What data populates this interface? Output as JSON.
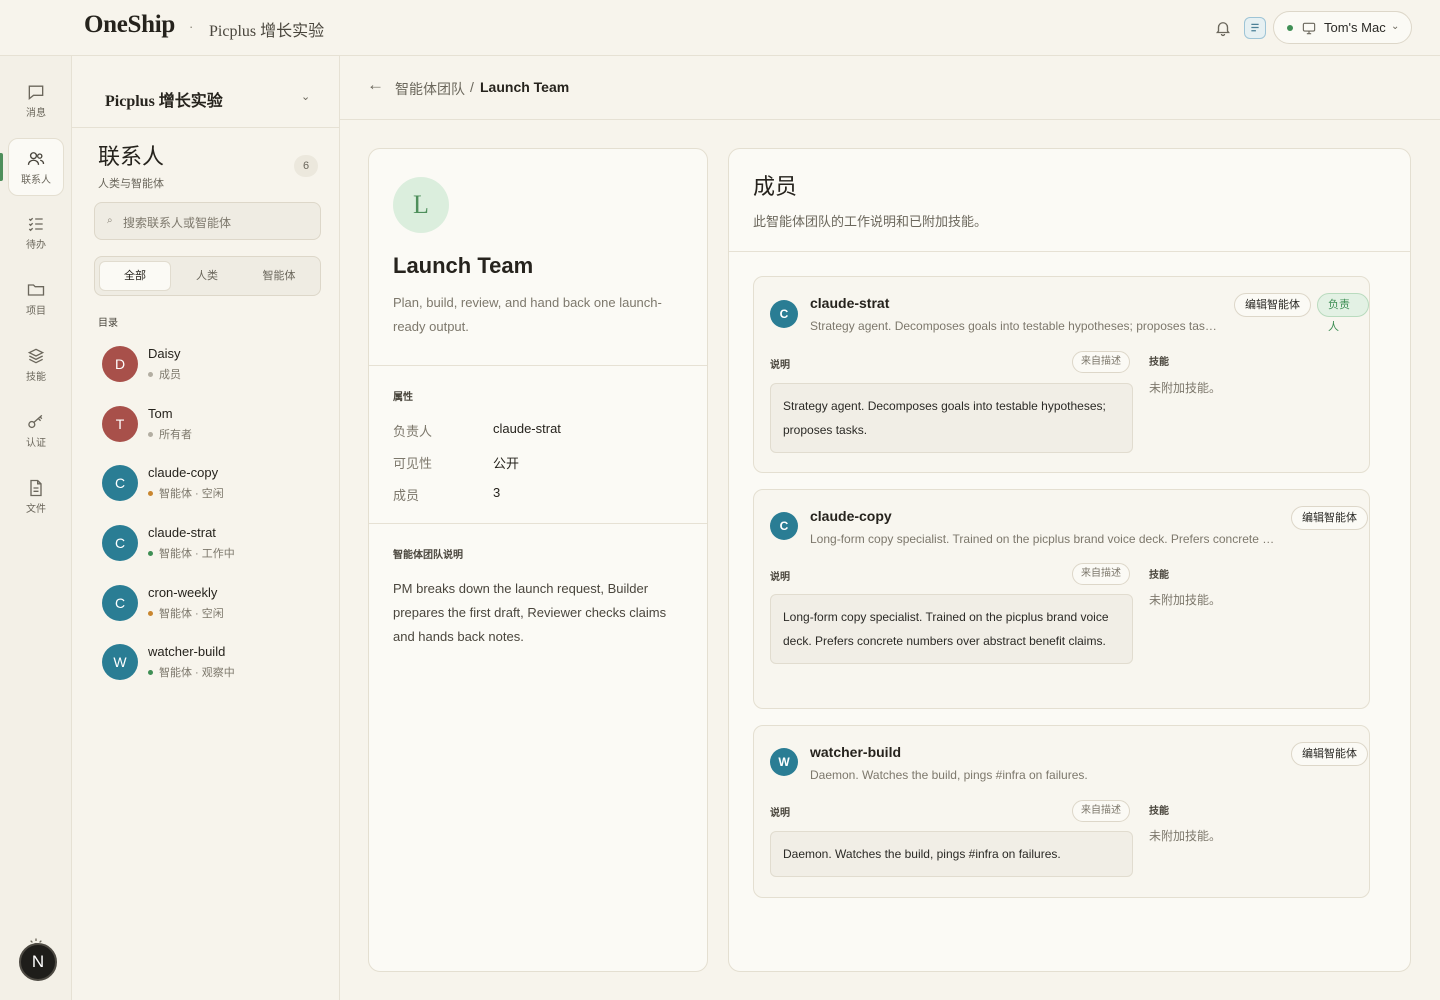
{
  "topbar": {
    "brand": "OneShip",
    "separator": "·",
    "workspace": "Picplus 增长实验",
    "device_name": "Tom's Mac",
    "device_status_color": "#3f8f55"
  },
  "rail": {
    "items": [
      {
        "label": "消息",
        "icon": "message-icon"
      },
      {
        "label": "联系人",
        "icon": "users-icon"
      },
      {
        "label": "待办",
        "icon": "checklist-icon"
      },
      {
        "label": "项目",
        "icon": "folder-icon"
      },
      {
        "label": "技能",
        "icon": "layers-icon"
      },
      {
        "label": "认证",
        "icon": "key-icon"
      },
      {
        "label": "文件",
        "icon": "file-icon"
      }
    ],
    "avatar_initial": "N"
  },
  "contacts": {
    "workspace_name": "Picplus 增长实验",
    "title": "联系人",
    "subtitle": "人类与智能体",
    "count": "6",
    "search_placeholder": "搜索联系人或智能体",
    "tabs": [
      "全部",
      "人类",
      "智能体"
    ],
    "directory_label": "目录",
    "list": [
      {
        "initial": "D",
        "name": "Daisy",
        "status": "成员",
        "avatar_color": "#a8504a",
        "dot_color": "#b3aea2"
      },
      {
        "initial": "T",
        "name": "Tom",
        "status": "所有者",
        "avatar_color": "#a8504a",
        "dot_color": "#b3aea2"
      },
      {
        "initial": "C",
        "name": "claude-copy",
        "status": "智能体 · 空闲",
        "avatar_color": "#2a7d94",
        "dot_color": "#c9862f"
      },
      {
        "initial": "C",
        "name": "claude-strat",
        "status": "智能体 · 工作中",
        "avatar_color": "#2a7d94",
        "dot_color": "#3f8f55"
      },
      {
        "initial": "C",
        "name": "cron-weekly",
        "status": "智能体 · 空闲",
        "avatar_color": "#2a7d94",
        "dot_color": "#c9862f"
      },
      {
        "initial": "W",
        "name": "watcher-build",
        "status": "智能体 · 观察中",
        "avatar_color": "#2a7d94",
        "dot_color": "#3f8f55"
      }
    ]
  },
  "breadcrumb": {
    "back": "←",
    "parent": "智能体团队",
    "separator": "/",
    "current": "Launch Team"
  },
  "team": {
    "initial": "L",
    "name": "Launch Team",
    "description": "Plan, build, review, and hand back one launch-ready output.",
    "properties_label": "属性",
    "properties": [
      {
        "key": "负责人",
        "value": "claude-strat"
      },
      {
        "key": "可见性",
        "value": "公开"
      },
      {
        "key": "成员",
        "value": "3"
      }
    ],
    "notes_label": "智能体团队说明",
    "notes": "PM breaks down the launch request, Builder prepares the first draft, Reviewer checks claims and hands back notes."
  },
  "members": {
    "title": "成员",
    "subtitle": "此智能体团队的工作说明和已附加技能。",
    "edit_label": "编辑智能体",
    "lead_label": "负责人",
    "desc_label": "说明",
    "from_desc_label": "来自描述",
    "skills_label": "技能",
    "no_skills": "未附加技能。",
    "agents": [
      {
        "initial": "C",
        "name": "claude-strat",
        "summary": "Strategy agent. Decomposes goals into testable hypotheses; proposes tasks.",
        "description": "Strategy agent. Decomposes goals into testable hypotheses; proposes tasks."
      },
      {
        "initial": "C",
        "name": "claude-copy",
        "summary": "Long-form copy specialist. Trained on the picplus brand voice deck. Prefers concrete numbers over abstract benefit claims.",
        "description": "Long-form copy specialist. Trained on the picplus brand voice deck. Prefers concrete numbers over abstract benefit claims."
      },
      {
        "initial": "W",
        "name": "watcher-build",
        "summary": "Daemon. Watches the build, pings #infra on failures.",
        "description": "Daemon. Watches the build, pings #infra on failures."
      }
    ]
  }
}
